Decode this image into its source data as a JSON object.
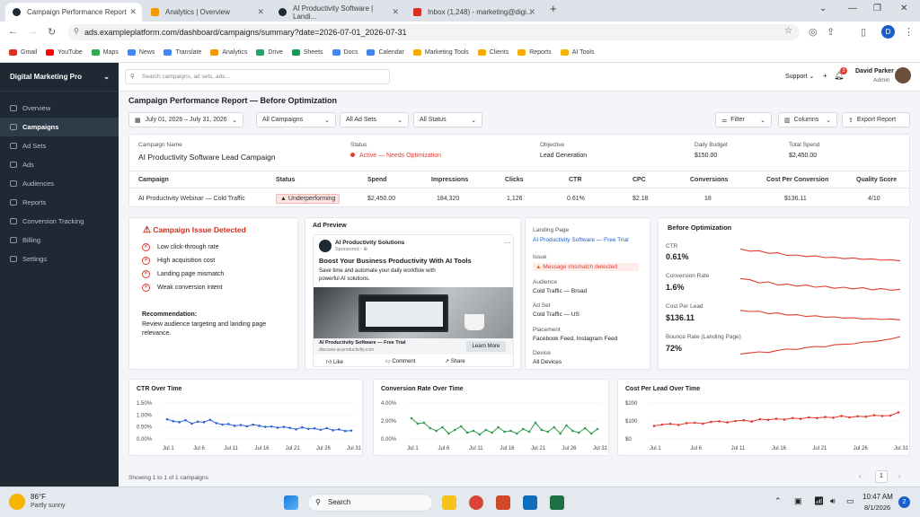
{
  "browser": {
    "tabs": [
      {
        "title": "Campaign Performance Report"
      },
      {
        "title": "Analytics | Overview"
      },
      {
        "title": "AI Productivity Software | Landi..."
      },
      {
        "title": "Inbox (1,248) - marketing@digi..."
      }
    ],
    "url": "ads.exampleplatform.com/dashboard/campaigns/summary?date=2026-07-01_2026-07-31",
    "profile": "D",
    "bookmarks": [
      "Gmail",
      "YouTube",
      "Maps",
      "News",
      "Translate",
      "Analytics",
      "Drive",
      "Sheets",
      "Docs",
      "Calendar",
      "Marketing Tools",
      "Clients",
      "Reports",
      "AI Tools"
    ]
  },
  "sidebar": {
    "brand": "Digital Marketing Pro",
    "items": [
      "Overview",
      "Campaigns",
      "Ad Sets",
      "Ads",
      "Audiences",
      "Reports",
      "Conversion Tracking",
      "Billing",
      "Settings"
    ],
    "active_index": 1
  },
  "topbar": {
    "search_placeholder": "Search campaigns, ad sets, ads...",
    "support": "Support",
    "notif_count": "3",
    "user_name": "David Parker",
    "user_role": "Admin"
  },
  "page": {
    "title": "Campaign Performance Report — Before Optimization"
  },
  "filters": {
    "date": "July 01, 2026 – July 31, 2026",
    "campaigns": "All Campaigns",
    "adsets": "All Ad Sets",
    "status": "All Status",
    "filter": "Filter",
    "columns": "Columns",
    "export": "Export Report"
  },
  "summary": {
    "campaign_label": "Campaign Name",
    "campaign": "AI Productivity Software Lead Campaign",
    "status_label": "Status",
    "status": "Active — Needs Optimization",
    "objective_label": "Objective",
    "objective": "Lead Generation",
    "budget_label": "Daily Budget",
    "budget": "$150.00",
    "spend_label": "Total Spend",
    "spend": "$2,450.00"
  },
  "table": {
    "headers": [
      "Campaign",
      "Status",
      "Spend",
      "Impressions",
      "Clicks",
      "CTR",
      "CPC",
      "Conversions",
      "Cost Per Conversion",
      "Quality Score"
    ],
    "row": [
      "AI Productivity Webinar — Cold Traffic",
      "Underperforming",
      "$2,450.00",
      "184,320",
      "1,126",
      "0.61%",
      "$2.18",
      "18",
      "$136.11",
      "4/10"
    ]
  },
  "issues": {
    "title": "Campaign Issue Detected",
    "items": [
      "Low click-through rate",
      "High acquisition cost",
      "Landing page mismatch",
      "Weak conversion intent"
    ],
    "rec_title": "Recommendation:",
    "rec_text": "Review audience targeting and landing page relevance."
  },
  "ad": {
    "header": "Ad Preview",
    "brand": "AI Productivity Solutions",
    "sponsored": "Sponsored · ⊕",
    "headline": "Boost Your Business Productivity With AI Tools",
    "body": "Save time and automate your daily workflow with powerful AI solutions.",
    "cta_title": "AI Productivity Software — Free Trial",
    "domain": "discover.ai-productivity.com",
    "cta_button": "Learn More",
    "actions": [
      "Like",
      "Comment",
      "Share"
    ]
  },
  "details": {
    "landing_label": "Landing Page",
    "landing": "AI Productivity Software — Free Trial",
    "issue_label": "Issue",
    "issue": "Message mismatch detected",
    "audience_label": "Audience",
    "audience": "Cold Traffic — Broad",
    "adset_label": "Ad Set",
    "adset": "Cold Traffic — US",
    "placement_label": "Placement",
    "placement": "Facebook Feed, Instagram Feed",
    "device_label": "Device",
    "device": "All Devices"
  },
  "before": {
    "title": "Before Optimization",
    "metrics": [
      {
        "label": "CTR",
        "value": "0.61%"
      },
      {
        "label": "Conversion Rate",
        "value": "1.6%"
      },
      {
        "label": "Cost Per Lead",
        "value": "$136.11"
      },
      {
        "label": "Bounce Rate (Landing Page)",
        "value": "72%"
      }
    ]
  },
  "chart_data": [
    {
      "type": "line",
      "title": "CTR Over Time",
      "x": [
        "Jul 1",
        "Jul 6",
        "Jul 11",
        "Jul 16",
        "Jul 21",
        "Jul 26",
        "Jul 31"
      ],
      "ytick_labels": [
        "1.50%",
        "1.00%",
        "0.50%",
        "0.00%"
      ],
      "ylim": [
        0,
        1.5
      ],
      "series": [
        {
          "values": [
            0.82,
            0.74,
            0.7,
            0.78,
            0.64,
            0.72,
            0.7,
            0.8,
            0.66,
            0.6,
            0.62,
            0.55,
            0.58,
            0.53,
            0.6,
            0.55,
            0.5,
            0.52,
            0.47,
            0.5,
            0.46,
            0.4,
            0.48,
            0.42,
            0.44,
            0.38,
            0.45,
            0.36,
            0.4,
            0.33,
            0.35
          ]
        }
      ],
      "color": "#3366d6"
    },
    {
      "type": "line",
      "title": "Conversion Rate Over Time",
      "x": [
        "Jul 1",
        "Jul 6",
        "Jul 11",
        "Jul 16",
        "Jul 21",
        "Jul 26",
        "Jul 31"
      ],
      "ytick_labels": [
        "4.00%",
        "2.00%",
        "0.00%"
      ],
      "ylim": [
        0,
        4
      ],
      "series": [
        {
          "values": [
            2.3,
            1.7,
            1.8,
            1.2,
            0.9,
            1.3,
            0.6,
            1.0,
            1.4,
            0.7,
            0.9,
            0.5,
            1.0,
            0.7,
            1.3,
            0.8,
            0.9,
            0.6,
            1.1,
            0.8,
            1.8,
            1.0,
            0.8,
            1.3,
            0.6,
            1.5,
            0.9,
            0.7,
            1.2,
            0.6,
            1.1
          ]
        }
      ],
      "color": "#2e9b4f"
    },
    {
      "type": "line",
      "title": "Cost Per Lead Over Time",
      "x": [
        "Jul 1",
        "Jul 6",
        "Jul 11",
        "Jul 16",
        "Jul 21",
        "Jul 26",
        "Jul 31"
      ],
      "ytick_labels": [
        "$200",
        "$100",
        "$0"
      ],
      "ylim": [
        0,
        200
      ],
      "series": [
        {
          "values": [
            72,
            80,
            84,
            78,
            88,
            90,
            85,
            95,
            98,
            92,
            100,
            104,
            97,
            110,
            106,
            112,
            108,
            116,
            112,
            120,
            116,
            122,
            118,
            128,
            120,
            126,
            124,
            132,
            128,
            130,
            148
          ]
        }
      ],
      "color": "#e03c31"
    }
  ],
  "sparklines": {
    "ctr": [
      0.9,
      0.8,
      0.82,
      0.7,
      0.72,
      0.6,
      0.62,
      0.55,
      0.58,
      0.5,
      0.52,
      0.45,
      0.48,
      0.42,
      0.44,
      0.38,
      0.4,
      0.35
    ],
    "conv": [
      0.9,
      0.85,
      0.7,
      0.75,
      0.6,
      0.65,
      0.55,
      0.6,
      0.5,
      0.55,
      0.45,
      0.5,
      0.42,
      0.48,
      0.38,
      0.44,
      0.36,
      0.4
    ],
    "cpl": [
      0.8,
      0.75,
      0.76,
      0.65,
      0.68,
      0.58,
      0.6,
      0.52,
      0.55,
      0.48,
      0.5,
      0.44,
      0.46,
      0.4,
      0.42,
      0.38,
      0.4,
      0.36
    ],
    "bounce": [
      0.15,
      0.2,
      0.25,
      0.22,
      0.32,
      0.38,
      0.36,
      0.45,
      0.5,
      0.48,
      0.58,
      0.6,
      0.62,
      0.7,
      0.72,
      0.78,
      0.85,
      0.95
    ]
  },
  "footer": {
    "showing": "Showing 1 to 1 of 1 campaigns",
    "page": "1"
  },
  "taskbar": {
    "temp": "86°F",
    "weather": "Partly sunny",
    "search": "Search",
    "time": "10:47 AM",
    "date": "8/1/2026",
    "notif": "2"
  }
}
